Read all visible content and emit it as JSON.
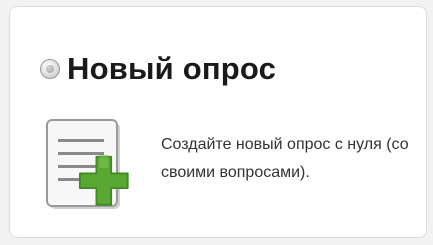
{
  "option": {
    "title": "Новый опрос",
    "description": "Создайте новый опрос с нуля (со своими вопросами).",
    "selected": false
  },
  "icons": {
    "radio": "radio-button-icon",
    "document": "new-document-add-icon"
  },
  "colors": {
    "title": "#1a1a1a",
    "description": "#333333",
    "plus": "#5aa832",
    "card_border": "#dcdcdc"
  }
}
